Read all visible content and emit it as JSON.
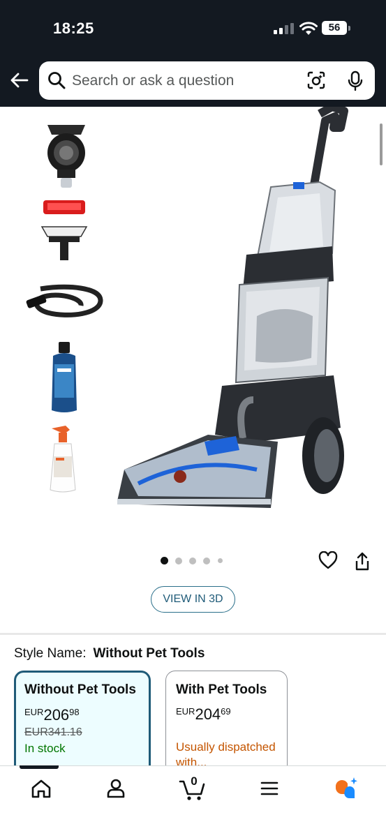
{
  "status_bar": {
    "time": "18:25",
    "battery": "56"
  },
  "search": {
    "placeholder": "Search or ask a question"
  },
  "view3d_label": "VIEW IN 3D",
  "style": {
    "label": "Style Name:",
    "selected": "Without Pet Tools",
    "options": [
      {
        "title": "Without Pet Tools",
        "currency": "EUR",
        "price_whole": "206",
        "price_fraction": "98",
        "old_price": "EUR341.16",
        "availability": "In stock"
      },
      {
        "title": "With Pet Tools",
        "currency": "EUR",
        "price_whole": "204",
        "price_fraction": "69",
        "availability": "Usually dispatched with..."
      }
    ]
  },
  "gallery": {
    "image_count": 5,
    "active_index": 0
  },
  "cart": {
    "count": "0"
  },
  "icons": [
    "back-arrow-icon",
    "search-icon",
    "camera-icon",
    "mic-icon",
    "heart-icon",
    "share-icon",
    "home-icon",
    "account-icon",
    "cart-icon",
    "menu-icon",
    "ai-assistant-icon"
  ],
  "colors": {
    "header": "#131921",
    "selected_border": "#1f5b78",
    "in_stock": "#007600",
    "dispatch": "#c45500"
  }
}
